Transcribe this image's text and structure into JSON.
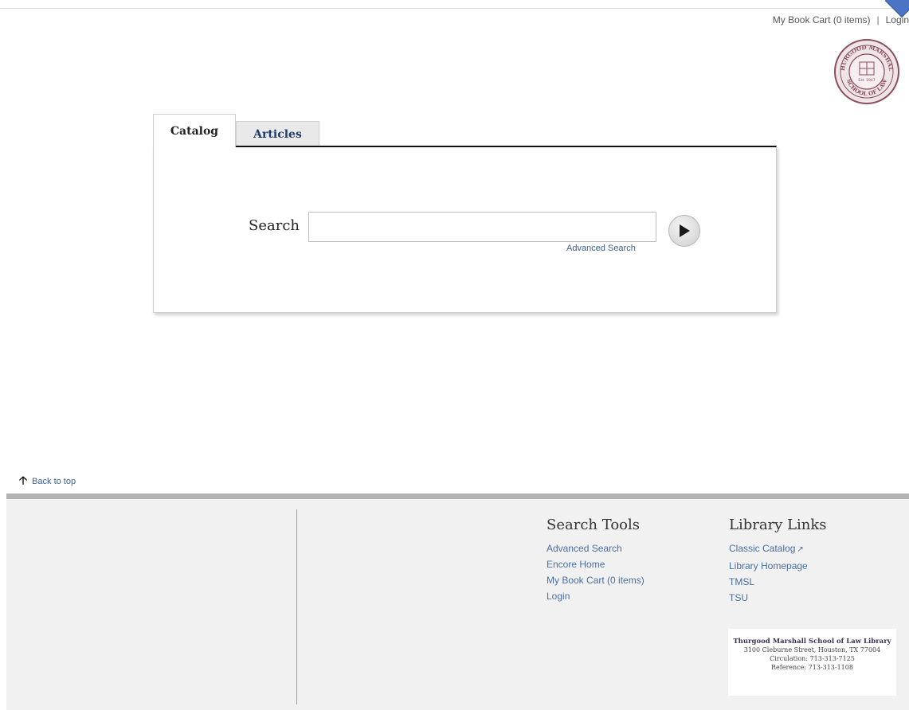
{
  "header": {
    "cart_link": "My Book Cart (0 items)",
    "separator": "|",
    "login_link": "Login",
    "seal_text_top": "THURGOOD MARSHALL",
    "seal_text_bottom": "SCHOOL OF LAW",
    "seal_est": "Est. 1947"
  },
  "search_panel": {
    "tabs": [
      {
        "label": "Catalog",
        "active": true
      },
      {
        "label": "Articles",
        "active": false
      }
    ],
    "search_label": "Search",
    "search_value": "",
    "advanced_search_link": "Advanced Search",
    "go_icon": "play-arrow-icon"
  },
  "back_to_top": {
    "label": "Back to top",
    "icon": "arrow-up-icon"
  },
  "footer": {
    "search_tools": {
      "heading": "Search Tools",
      "links": [
        "Advanced Search",
        "Encore Home",
        "My Book Cart (0 items)",
        "Login"
      ]
    },
    "library_links": {
      "heading": "Library Links",
      "links": [
        "Classic Catalog",
        "Library Homepage",
        "TMSL",
        "TSU"
      ],
      "external_icon": "external-link-icon"
    },
    "address_card": {
      "name": "Thurgood Marshall School of Law Library",
      "street": "3100 Cleburne Street, Houston, TX 77004",
      "circulation": "Circulation: 713-313-7125",
      "reference": "Reference: 713-313-1108"
    }
  },
  "colors": {
    "link": "#4a6fa5",
    "footer_bg": "#f1f1f1",
    "seal": "#8c4f5e",
    "accent_tab": "#4b74c4"
  }
}
